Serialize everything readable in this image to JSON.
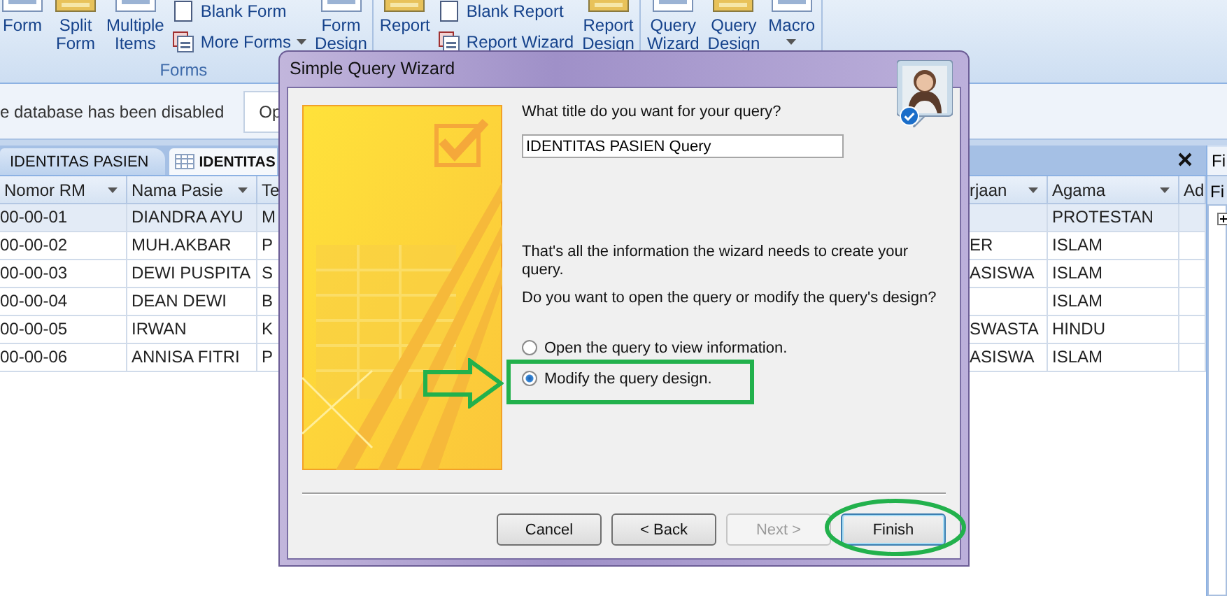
{
  "ribbon": {
    "groups": [
      {
        "label": "Forms",
        "items": [
          {
            "kind": "large",
            "label": "Form"
          },
          {
            "kind": "large",
            "label": "Split Form"
          },
          {
            "kind": "large",
            "label": "Multiple Items"
          },
          {
            "kind": "stack",
            "items": [
              {
                "label": "Blank Form",
                "dropdown": false
              },
              {
                "label": "More Forms",
                "dropdown": true
              }
            ]
          },
          {
            "kind": "large",
            "label": "Form Design"
          }
        ]
      },
      {
        "items": [
          {
            "kind": "large",
            "label": "Report"
          },
          {
            "kind": "stack",
            "items": [
              {
                "label": "Blank Report",
                "dropdown": false
              },
              {
                "label": "Report Wizard",
                "dropdown": false
              }
            ]
          },
          {
            "kind": "large",
            "label": "Report Design"
          }
        ]
      },
      {
        "items": [
          {
            "kind": "large",
            "label": "Query Wizard"
          },
          {
            "kind": "large",
            "label": "Query Design"
          },
          {
            "kind": "large",
            "label": "Macro",
            "dropdown": true
          }
        ]
      }
    ]
  },
  "message_bar": {
    "text": "e database has been disabled",
    "button": "Op"
  },
  "tabs": [
    {
      "label": "IDENTITAS PASIEN",
      "selected": false
    },
    {
      "label": "IDENTITAS",
      "selected": true
    }
  ],
  "table": {
    "columns": [
      {
        "label": "Nomor RM",
        "menu": true
      },
      {
        "label": "Nama Pasie",
        "menu": true
      },
      {
        "label": "Te",
        "menu": false
      },
      {
        "label": "rjaan",
        "menu": true
      },
      {
        "label": "Agama",
        "menu": true
      },
      {
        "label": "Ad",
        "menu": false
      }
    ],
    "rows": [
      {
        "selected": true,
        "cells": [
          "00-00-01",
          "DIANDRA AYU",
          "M",
          null,
          "PROTESTAN",
          null
        ]
      },
      {
        "selected": false,
        "cells": [
          "00-00-02",
          "MUH.AKBAR",
          "P",
          "ER",
          "ISLAM",
          null
        ]
      },
      {
        "selected": false,
        "cells": [
          "00-00-03",
          "DEWI PUSPITA",
          "S",
          "ASISWA",
          "ISLAM",
          null
        ]
      },
      {
        "selected": false,
        "cells": [
          "00-00-04",
          "DEAN DEWI",
          "B",
          null,
          "ISLAM",
          null
        ]
      },
      {
        "selected": false,
        "cells": [
          "00-00-05",
          "IRWAN",
          "K",
          "SWASTA",
          "HINDU",
          null
        ]
      },
      {
        "selected": false,
        "cells": [
          "00-00-06",
          "ANNISA FITRI",
          "P",
          "ASISWA",
          "ISLAM",
          null
        ]
      }
    ]
  },
  "field_panel": {
    "title": "Fi",
    "label": "Fi"
  },
  "dialog": {
    "title": "Simple Query Wizard",
    "question": "What title do you want for your query?",
    "title_value": "IDENTITAS PASIEN Query",
    "info": "That's all the information the wizard needs to create your query.",
    "question_2": "Do you want to open the query or modify the query's design?",
    "options": [
      {
        "label": "Open the query to view information.",
        "selected": false
      },
      {
        "label": "Modify the query design.",
        "selected": true
      }
    ],
    "buttons": [
      {
        "label": "Cancel",
        "disabled": false,
        "default": false
      },
      {
        "label": "< Back",
        "disabled": false,
        "default": false
      },
      {
        "label": "Next >",
        "disabled": true,
        "default": false
      },
      {
        "label": "Finish",
        "disabled": false,
        "default": true
      }
    ]
  },
  "annotations": [
    {
      "kind": "arrow"
    },
    {
      "kind": "frame"
    },
    {
      "kind": "ellipse"
    }
  ]
}
